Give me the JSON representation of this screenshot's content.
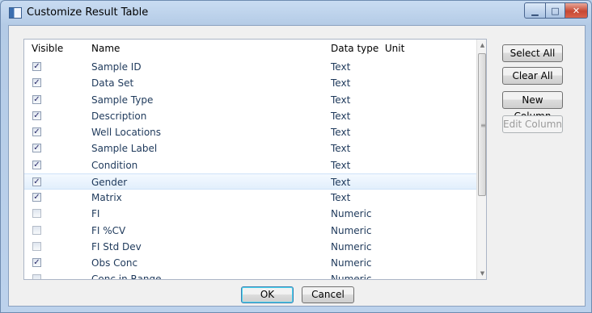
{
  "window": {
    "title": "Customize Result Table",
    "minimize_glyph": "▁",
    "maximize_glyph": "□",
    "close_glyph": "✕"
  },
  "table": {
    "headers": {
      "visible": "Visible",
      "name": "Name",
      "type_unit": "Data type  Unit"
    },
    "rows": [
      {
        "checked": true,
        "check": "✓",
        "name": "Sample ID",
        "type": "Text"
      },
      {
        "checked": true,
        "check": "✓",
        "name": "Data Set",
        "type": "Text"
      },
      {
        "checked": true,
        "check": "✓",
        "name": "Sample Type",
        "type": "Text"
      },
      {
        "checked": true,
        "check": "✓",
        "name": "Description",
        "type": "Text"
      },
      {
        "checked": true,
        "check": "✓",
        "name": "Well Locations",
        "type": "Text"
      },
      {
        "checked": true,
        "check": "✓",
        "name": "Sample Label",
        "type": "Text"
      },
      {
        "checked": true,
        "check": "✓",
        "name": "Condition",
        "type": "Text"
      },
      {
        "checked": true,
        "check": "✓",
        "name": "Gender",
        "type": "Text"
      },
      {
        "checked": true,
        "check": "✓",
        "name": "Matrix",
        "type": "Text"
      },
      {
        "checked": false,
        "check": "",
        "name": "FI",
        "type": "Numeric"
      },
      {
        "checked": false,
        "check": "",
        "name": "FI %CV",
        "type": "Numeric"
      },
      {
        "checked": false,
        "check": "",
        "name": "FI Std Dev",
        "type": "Numeric"
      },
      {
        "checked": true,
        "check": "✓",
        "name": "Obs Conc",
        "type": "Numeric"
      },
      {
        "checked": false,
        "check": "",
        "name": "Conc in Range",
        "type": "Numeric"
      }
    ],
    "selected_row": "Gender",
    "scroll_up_glyph": "▲",
    "scroll_down_glyph": "▼",
    "grip_glyph": "≡"
  },
  "buttons": {
    "select_all": "Select All",
    "clear_all": "Clear All",
    "new_column": "New Column",
    "edit_column": "Edit Column",
    "ok": "OK",
    "cancel": "Cancel"
  }
}
